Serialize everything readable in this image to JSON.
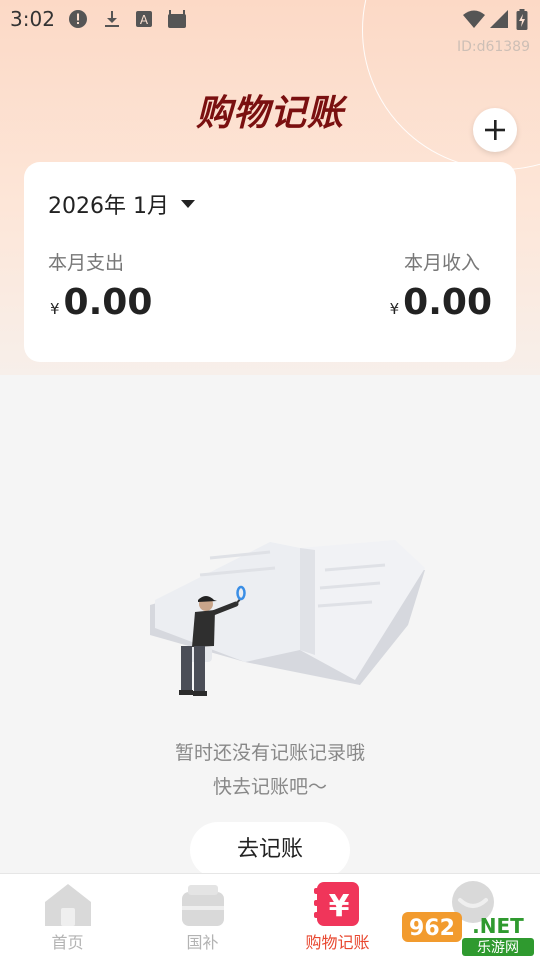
{
  "status_bar": {
    "time": "3:02",
    "left_icons": [
      "alert-icon",
      "download-icon",
      "a-box-icon",
      "android-icon"
    ],
    "right_icons": [
      "wifi-icon",
      "signal-icon",
      "battery-icon"
    ]
  },
  "header": {
    "watermark_id": "ID:d61389",
    "title": "购物记账",
    "add_button_icon": "plus-icon"
  },
  "summary": {
    "month": "2026年 1月",
    "expense_label": "本月支出",
    "expense_currency": "¥",
    "expense_value": "0.00",
    "income_label": "本月收入",
    "income_currency": "¥",
    "income_value": "0.00"
  },
  "empty_state": {
    "illustration": "open-book-with-person-illustration",
    "line1": "暂时还没有记账记录哦",
    "line2": "快去记账吧～",
    "button_label": "去记账"
  },
  "nav": {
    "items": [
      {
        "label": "首页",
        "icon": "home-icon",
        "active": false
      },
      {
        "label": "国补",
        "icon": "wallet-icon",
        "active": false
      },
      {
        "label": "购物记账",
        "icon": "yuan-ledger-icon",
        "active": true
      },
      {
        "label": "",
        "icon": "profile-icon",
        "active": false
      }
    ]
  },
  "watermark_badge": {
    "top_text": "962.NET",
    "bottom_text": "乐游网"
  },
  "colors": {
    "title": "#7a1010",
    "accent": "#e8472f",
    "active_icon": "#f0355a",
    "hero_top": "#fcd9c6"
  }
}
